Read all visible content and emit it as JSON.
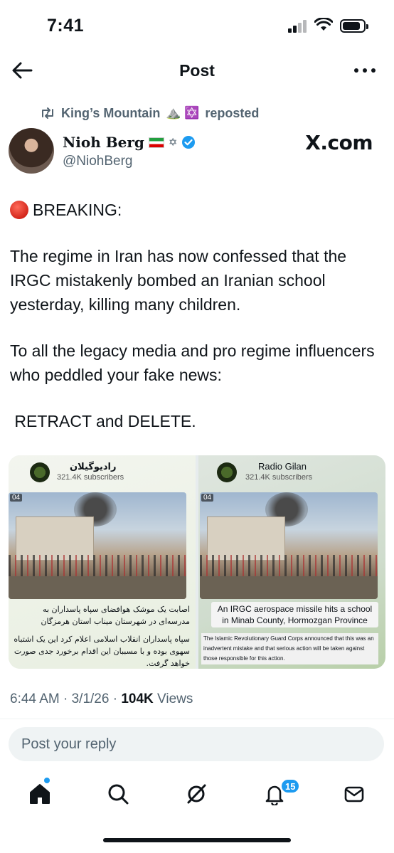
{
  "status_bar": {
    "time": "7:41",
    "battery_level": 0.85
  },
  "header": {
    "title": "Post"
  },
  "repost": {
    "label": "King’s Mountain",
    "emoji": "⛰️ ✡️",
    "suffix": "reposted"
  },
  "author": {
    "name": "Nioh Berg",
    "name_emoji": "✡",
    "handle": "@NiohBerg",
    "verified": true
  },
  "watermark": "X.com",
  "post": {
    "breaking": "BREAKING:",
    "paragraph_1": "The regime in Iran has now confessed that the IRGC mistakenly bombed an Iranian school yesterday, killing many children.",
    "paragraph_2": "To all the legacy media and pro regime influencers who peddled your fake news:",
    "paragraph_3": " RETRACT and DELETE."
  },
  "media": {
    "left": {
      "channel_name": "راديوگيلان",
      "subscribers": "321.4K subscribers",
      "timecode": "04",
      "caption_1": "اصابت یک موشک هوافضای سپاه پاسداران به مدرسه‌ای در شهرستان میناب استان هرمزگان",
      "caption_2": "سپاه پاسداران انقلاب اسلامی اعلام کرد این یک اشتباه سهوی بوده و با مسببان این اقدام برخورد جدی صورت خواهد گرفت."
    },
    "right": {
      "channel_name": "Radio Gilan",
      "subscribers": "321.4K subscribers",
      "timecode": "04",
      "caption_1": "An IRGC aerospace missile hits a school in Minab County, Hormozgan Province",
      "caption_2": "The Islamic Revolutionary Guard Corps announced that this was an inadvertent mistake and that serious action will be taken against those responsible for this action."
    }
  },
  "meta": {
    "time": "6:44 AM",
    "date": "3/1/26",
    "views_count": "104K",
    "views_label": "Views",
    "separator": "·"
  },
  "reply": {
    "placeholder": "Post your reply"
  },
  "nav": {
    "notifications_badge": "15"
  },
  "colors": {
    "accent": "#1d9bf0",
    "text_secondary": "#536471",
    "text_primary": "#0f1419"
  }
}
